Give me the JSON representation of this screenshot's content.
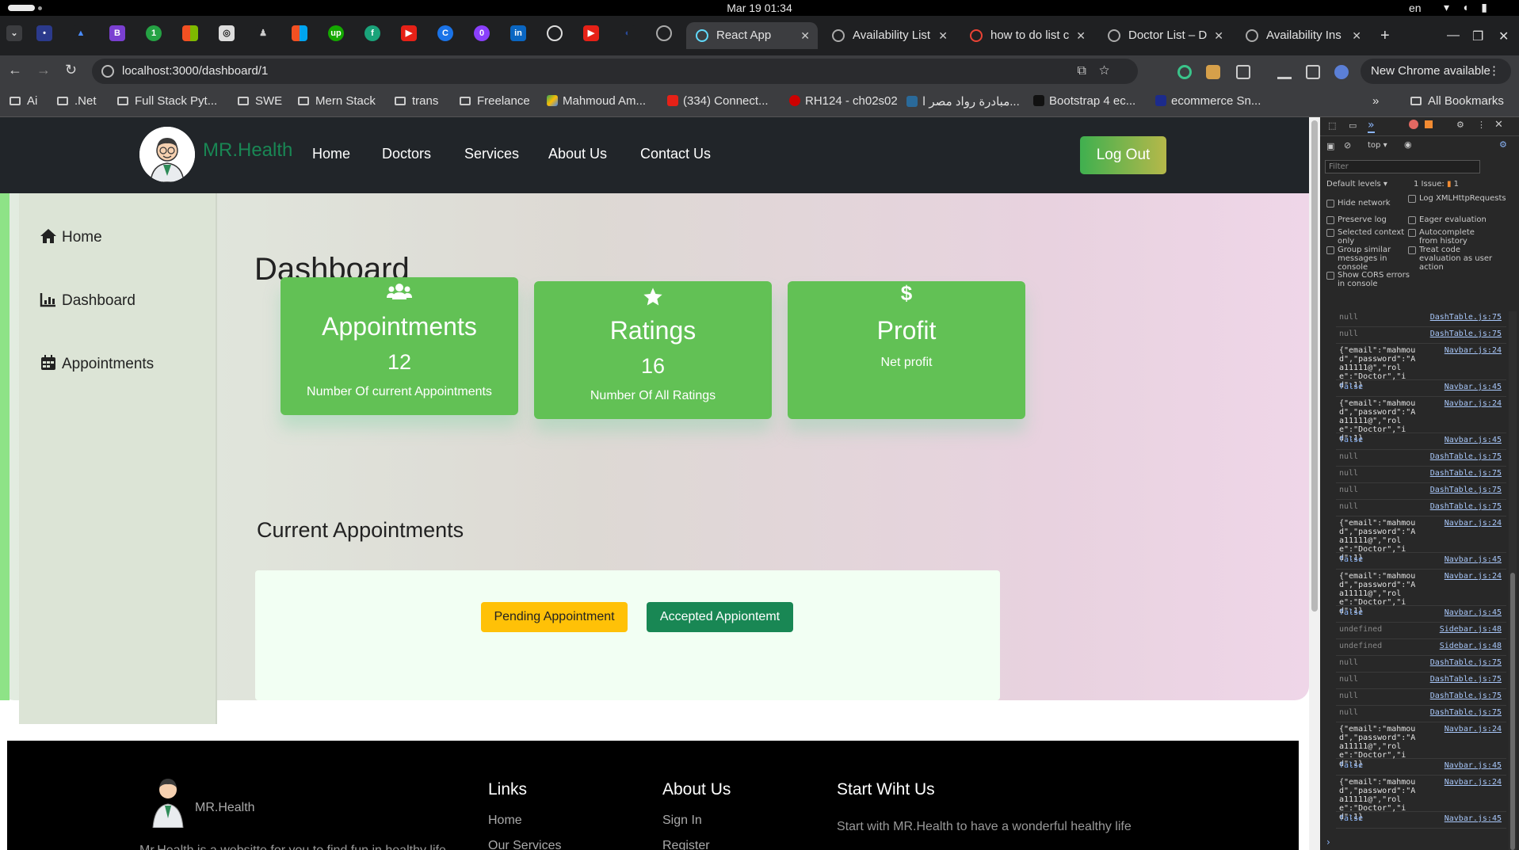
{
  "os": {
    "clock": "Mar 19  01:34",
    "lang": "en"
  },
  "tabs": [
    {
      "label": "React App",
      "active": true
    },
    {
      "label": "Availability List",
      "active": false
    },
    {
      "label": "how to do list c",
      "active": false
    },
    {
      "label": "Doctor List – D",
      "active": false
    },
    {
      "label": "Availability Ins",
      "active": false
    }
  ],
  "address": {
    "url": "localhost:3000/dashboard/1",
    "update_label": "New Chrome available"
  },
  "bookmarks": [
    "Ai",
    ".Net",
    "Full Stack Pyt...",
    "SWE",
    "Mern Stack",
    "trans",
    "Freelance",
    "Mahmoud Am...",
    "(334) Connect...",
    "RH124 - ch02s02",
    "مبادرة رواد مصر ا...",
    "Bootstrap 4 ec...",
    "ecommerce Sn..."
  ],
  "all_bookmarks": "All Bookmarks",
  "site": {
    "brand": "MR.Health",
    "nav": [
      "Home",
      "Doctors",
      "Services",
      "About Us",
      "Contact Us"
    ],
    "logout": "Log Out",
    "sidebar": [
      {
        "label": "Home",
        "icon": "home-icon"
      },
      {
        "label": "Dashboard",
        "icon": "chart-icon"
      },
      {
        "label": "Appointments",
        "icon": "calendar-icon"
      }
    ],
    "dashboard_title": "Dashboard",
    "cards": [
      {
        "title": "Appointments",
        "value": "12",
        "subtitle": "Number Of current Appointments",
        "icon": "users-icon"
      },
      {
        "title": "Ratings",
        "value": "16",
        "subtitle": "Number Of All Ratings",
        "icon": "star-icon"
      },
      {
        "title": "Profit",
        "value": "",
        "subtitle": "Net profit",
        "icon": "dollar-icon"
      }
    ],
    "current_appointments_title": "Current Appointments",
    "pending_button": "Pending Appointment",
    "accepted_button": "Accepted Appiontemt",
    "footer": {
      "brand": "MR.Health",
      "tagline": "Mr.Health is a websitte for you to find fun in healthy life",
      "links_title": "Links",
      "links": [
        "Home",
        "Our Services"
      ],
      "about_title": "About Us",
      "about_links": [
        "Sign In",
        "Register"
      ],
      "start_title": "Start Wiht Us",
      "start_text": "Start with MR.Health to have a wonderful healthy life"
    }
  },
  "devtools": {
    "context": "top",
    "filter_placeholder": "Filter",
    "levels": "Default levels",
    "issues": "1 Issue:",
    "issues_count": "1",
    "options": [
      "Hide network",
      "Log XMLHttpRequests",
      "Preserve log",
      "Eager evaluation",
      "Selected context only",
      "Autocomplete from history",
      "Group similar messages in console",
      "Treat code evaluation as user action",
      "Show CORS errors in console"
    ],
    "log": [
      {
        "msg": "null",
        "src": "DashTable.js:75",
        "kind": "nul"
      },
      {
        "msg": "null",
        "src": "DashTable.js:75",
        "kind": "nul"
      },
      {
        "msg": "{\"email\":\"mahmoud\",\"password\":\"Aa11111@\",\"role\":\"Doctor\",\"id\":1}",
        "src": "Navbar.js:24",
        "kind": "obj"
      },
      {
        "msg": "false",
        "src": "Navbar.js:45",
        "kind": "bool"
      },
      {
        "msg": "{\"email\":\"mahmoud\",\"password\":\"Aa11111@\",\"role\":\"Doctor\",\"id\":1}",
        "src": "Navbar.js:24",
        "kind": "obj"
      },
      {
        "msg": "false",
        "src": "Navbar.js:45",
        "kind": "bool"
      },
      {
        "msg": "null",
        "src": "DashTable.js:75",
        "kind": "nul"
      },
      {
        "msg": "null",
        "src": "DashTable.js:75",
        "kind": "nul"
      },
      {
        "msg": "null",
        "src": "DashTable.js:75",
        "kind": "nul"
      },
      {
        "msg": "null",
        "src": "DashTable.js:75",
        "kind": "nul"
      },
      {
        "msg": "{\"email\":\"mahmoud\",\"password\":\"Aa11111@\",\"role\":\"Doctor\",\"id\":1}",
        "src": "Navbar.js:24",
        "kind": "obj"
      },
      {
        "msg": "false",
        "src": "Navbar.js:45",
        "kind": "bool"
      },
      {
        "msg": "{\"email\":\"mahmoud\",\"password\":\"Aa11111@\",\"role\":\"Doctor\",\"id\":1}",
        "src": "Navbar.js:24",
        "kind": "obj"
      },
      {
        "msg": "false",
        "src": "Navbar.js:45",
        "kind": "bool"
      },
      {
        "msg": "undefined",
        "src": "Sidebar.js:48",
        "kind": "nul"
      },
      {
        "msg": "undefined",
        "src": "Sidebar.js:48",
        "kind": "nul"
      },
      {
        "msg": "null",
        "src": "DashTable.js:75",
        "kind": "nul"
      },
      {
        "msg": "null",
        "src": "DashTable.js:75",
        "kind": "nul"
      },
      {
        "msg": "null",
        "src": "DashTable.js:75",
        "kind": "nul"
      },
      {
        "msg": "null",
        "src": "DashTable.js:75",
        "kind": "nul"
      },
      {
        "msg": "{\"email\":\"mahmoud\",\"password\":\"Aa11111@\",\"role\":\"Doctor\",\"id\":1}",
        "src": "Navbar.js:24",
        "kind": "obj"
      },
      {
        "msg": "false",
        "src": "Navbar.js:45",
        "kind": "bool"
      },
      {
        "msg": "{\"email\":\"mahmoud\",\"password\":\"Aa11111@\",\"role\":\"Doctor\",\"id\":1}",
        "src": "Navbar.js:24",
        "kind": "obj"
      },
      {
        "msg": "false",
        "src": "Navbar.js:45",
        "kind": "bool"
      }
    ]
  }
}
